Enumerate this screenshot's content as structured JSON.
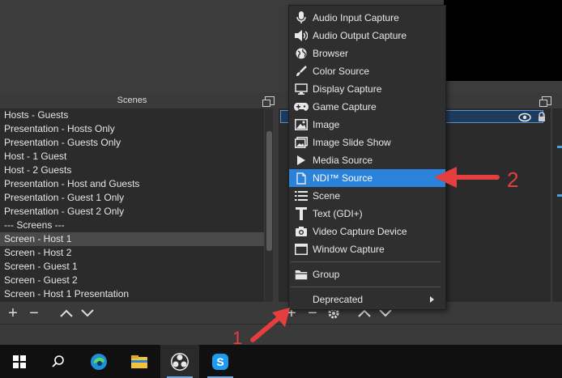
{
  "scenes_panel": {
    "title": "Scenes",
    "items": [
      "Hosts - Guests",
      "Presentation - Hosts Only",
      "Presentation - Guests Only",
      "Host - 1 Guest",
      "Host - 2 Guests",
      "Presentation - Host and Guests",
      "Presentation - Guest 1 Only",
      "Presentation - Guest 2 Only",
      "--- Screens ---",
      "Screen - Host 1",
      "Screen - Host 2",
      "Screen - Guest 1",
      "Screen - Guest 2",
      "Screen - Host 1 Presentation"
    ],
    "selected_index": 9
  },
  "context_menu": {
    "items": [
      {
        "label": "Audio Input Capture",
        "icon": "microphone-icon"
      },
      {
        "label": "Audio Output Capture",
        "icon": "speaker-icon"
      },
      {
        "label": "Browser",
        "icon": "globe-icon"
      },
      {
        "label": "Color Source",
        "icon": "brush-icon"
      },
      {
        "label": "Display Capture",
        "icon": "monitor-icon"
      },
      {
        "label": "Game Capture",
        "icon": "gamepad-icon"
      },
      {
        "label": "Image",
        "icon": "image-icon"
      },
      {
        "label": "Image Slide Show",
        "icon": "slideshow-icon"
      },
      {
        "label": "Media Source",
        "icon": "play-icon"
      },
      {
        "label": "NDI™ Source",
        "icon": "file-icon"
      },
      {
        "label": "Scene",
        "icon": "list-icon"
      },
      {
        "label": "Text (GDI+)",
        "icon": "text-icon"
      },
      {
        "label": "Video Capture Device",
        "icon": "camera-icon"
      },
      {
        "label": "Window Capture",
        "icon": "window-icon"
      }
    ],
    "highlighted_index": 9,
    "group_label": "Group",
    "deprecated_label": "Deprecated"
  },
  "annotations": {
    "step1": "1",
    "step2": "2",
    "color": "#e53e3e"
  },
  "colors": {
    "highlight": "#2a82da",
    "panel_bg": "#2b2b2b",
    "menu_bg": "#2f2f2f"
  },
  "taskbar": {
    "icons": [
      "windows-start-icon",
      "search-icon",
      "edge-icon",
      "file-explorer-icon",
      "obs-icon",
      "skype-icon"
    ]
  }
}
